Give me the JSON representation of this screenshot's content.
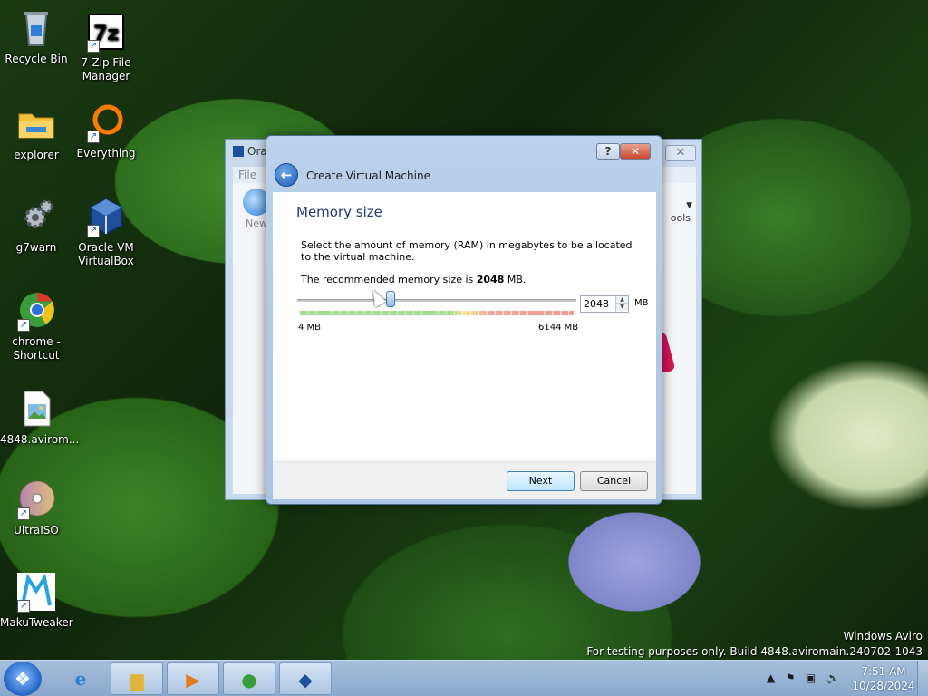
{
  "desktop": {
    "icons": [
      {
        "label": "Recycle Bin",
        "icon": "recycle-bin-icon"
      },
      {
        "label": "7-Zip File Manager",
        "icon": "7zip-icon"
      },
      {
        "label": "explorer",
        "icon": "folder-icon"
      },
      {
        "label": "Everything",
        "icon": "everything-icon"
      },
      {
        "label": "g7warn",
        "icon": "gears-icon"
      },
      {
        "label": "Oracle VM VirtualBox",
        "icon": "virtualbox-icon"
      },
      {
        "label": "chrome - Shortcut",
        "icon": "chrome-icon"
      },
      {
        "label": "4848.avirom...",
        "icon": "image-file-icon"
      },
      {
        "label": "UltraISO",
        "icon": "disc-icon"
      },
      {
        "label": "MakuTweaker",
        "icon": "makutweaker-icon"
      }
    ]
  },
  "background_window": {
    "title": "Ora",
    "menu_file": "File",
    "new_label": "New",
    "tools_label": "ools"
  },
  "dialog": {
    "title": "Create Virtual Machine",
    "section_title": "Memory size",
    "description": "Select the amount of memory (RAM) in megabytes to be allocated to the virtual machine.",
    "recommended_prefix": "The recommended memory size is ",
    "recommended_value": "2048",
    "recommended_suffix": " MB.",
    "slider": {
      "min": 4,
      "max": 6144,
      "value": 2048
    },
    "min_label": "4 MB",
    "max_label": "6144 MB",
    "memory_value": "2048",
    "unit": "MB",
    "help_label": "?",
    "close_label": "✕",
    "next_label": "Next",
    "cancel_label": "Cancel"
  },
  "watermark": {
    "line1": "Windows Aviro",
    "line2": "For testing purposes only. Build 4848.aviromain.240702-1043"
  },
  "taskbar": {
    "time": "7:51 AM",
    "date": "10/28/2024"
  }
}
